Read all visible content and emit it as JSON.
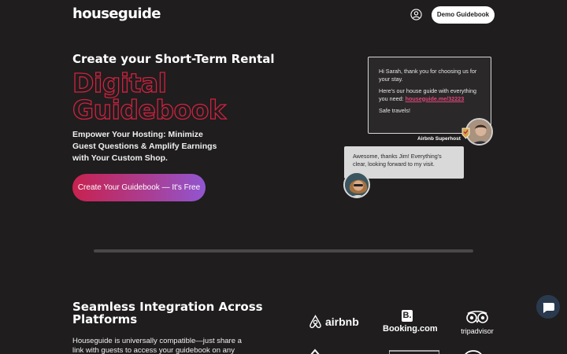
{
  "nav": {
    "logo": "houseguide",
    "demo_label": "Demo Guidebook"
  },
  "hero": {
    "subtitle": "Create your Short-Term Rental",
    "title_line1": "Digital",
    "title_line2": "Guidebook",
    "description": "Empower Your Hosting: Minimize Guest Questions & Amplify Earnings with Your Custom Shop.",
    "cta_label": "Create Your Guidebook — It's Free"
  },
  "chat_demo": {
    "host_greeting": "Hi Sarah, thank you for choosing us for your stay.",
    "host_intro": "Here's our house guide with everything you need:",
    "host_link": "houseguide.me/32223",
    "host_signoff": "Safe travels!",
    "host_label": "Airbnb Superhost",
    "guest_reply": "Awesome, thanks Jim! Everything's clear, looking forward to my visit."
  },
  "integration": {
    "title": "Seamless Integration Across Platforms",
    "description": "Houseguide is universally compatible—just share a link with guests to access your guidebook on any",
    "logos": {
      "airbnb": "airbnb",
      "booking": "Booking.com",
      "booking_mark": "B.",
      "tripadvisor": "tripadvisor"
    }
  },
  "colors": {
    "background": "#1f1d1e",
    "accent_red": "#d0223f",
    "gradient_end": "#9156d1",
    "link_pink": "#e0477a"
  },
  "icons": {
    "user": "user-circle-icon",
    "chat": "chat-bubble-icon",
    "badge": "superhost-badge-icon"
  }
}
